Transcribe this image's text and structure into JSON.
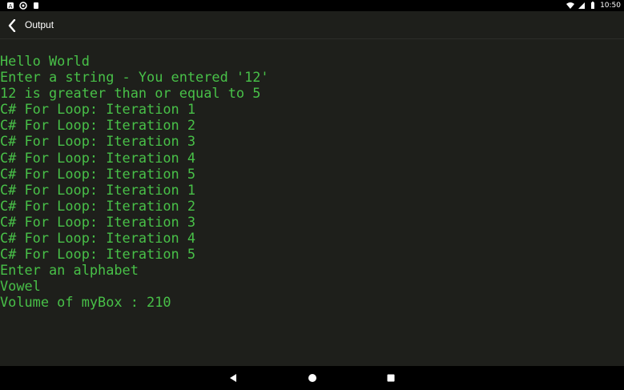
{
  "status_bar": {
    "time": "10:50",
    "left_icons": [
      "android-notification-icon",
      "sync-icon",
      "clipboard-icon"
    ],
    "right_icons": [
      "wifi-icon",
      "signal-icon",
      "battery-icon"
    ]
  },
  "app_bar": {
    "title": "Output",
    "back_icon": "chevron-left-icon"
  },
  "console": {
    "lines": [
      "Hello World",
      "Enter a string - You entered '12'",
      "12 is greater than or equal to 5",
      "C# For Loop: Iteration 1",
      "C# For Loop: Iteration 2",
      "C# For Loop: Iteration 3",
      "C# For Loop: Iteration 4",
      "C# For Loop: Iteration 5",
      "C# For Loop: Iteration 1",
      "C# For Loop: Iteration 2",
      "C# For Loop: Iteration 3",
      "C# For Loop: Iteration 4",
      "C# For Loop: Iteration 5",
      "Enter an alphabet",
      "Vowel",
      "Volume of myBox : 210"
    ]
  },
  "nav_bar": {
    "buttons": [
      "back-triangle-icon",
      "home-circle-icon",
      "recents-square-icon"
    ]
  },
  "colors": {
    "background": "#1e1f1b",
    "console_text": "#48c048",
    "bars": "#000000"
  }
}
